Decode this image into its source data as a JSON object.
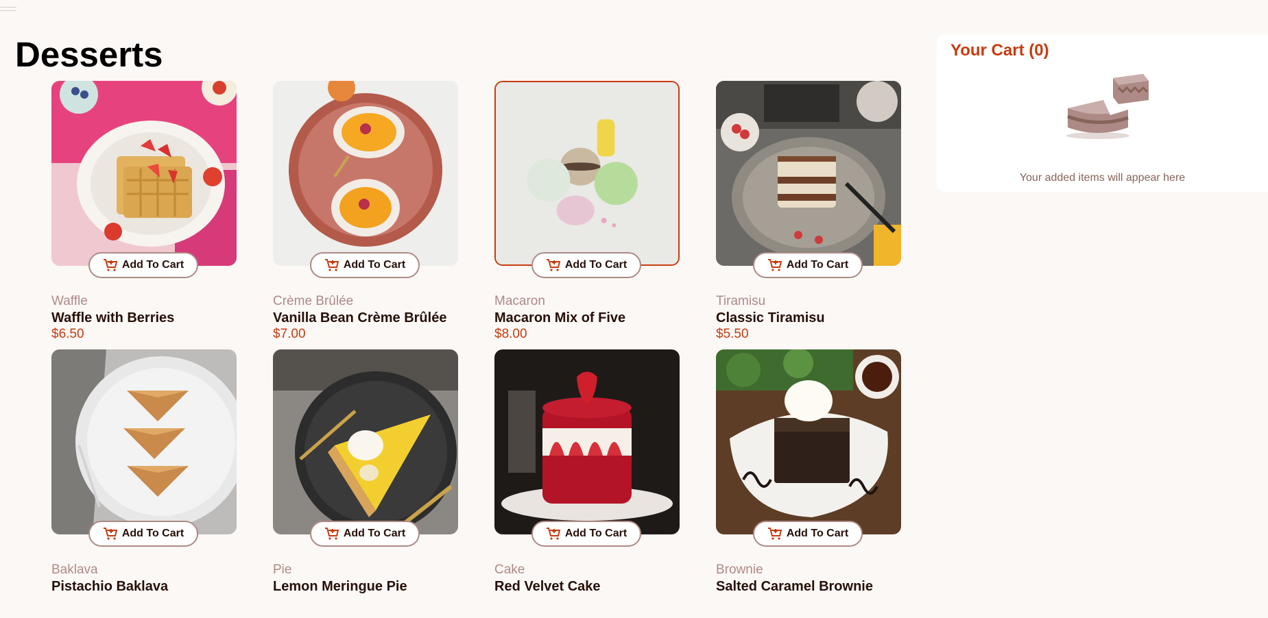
{
  "page": {
    "title": "Desserts"
  },
  "products": [
    {
      "category": "Waffle",
      "name": "Waffle with Berries",
      "price": "$6.50",
      "image": "waffle-image",
      "button": "Add To Cart"
    },
    {
      "category": "Crème Brûlée",
      "name": "Vanilla Bean Crème Brûlée",
      "price": "$7.00",
      "image": "creme-brulee-image",
      "button": "Add To Cart"
    },
    {
      "category": "Macaron",
      "name": "Macaron Mix of Five",
      "price": "$8.00",
      "image": "macaron-image",
      "button": "Add To Cart"
    },
    {
      "category": "Tiramisu",
      "name": "Classic Tiramisu",
      "price": "$5.50",
      "image": "tiramisu-image",
      "button": "Add To Cart"
    },
    {
      "category": "Baklava",
      "name": "Pistachio Baklava",
      "price": "",
      "image": "baklava-image",
      "button": "Add To Cart"
    },
    {
      "category": "Pie",
      "name": "Lemon Meringue Pie",
      "price": "",
      "image": "pie-image",
      "button": "Add To Cart"
    },
    {
      "category": "Cake",
      "name": "Red Velvet Cake",
      "price": "",
      "image": "cake-image",
      "button": "Add To Cart"
    },
    {
      "category": "Brownie",
      "name": "Salted Caramel Brownie",
      "price": "",
      "image": "brownie-image",
      "button": "Add To Cart"
    }
  ],
  "cart": {
    "title": "Your Cart (0)",
    "empty_message": "Your added items will appear here",
    "illustration": "empty-cart-cake-icon"
  },
  "colors": {
    "accent": "#c73b0f",
    "background": "#fcf8f6",
    "muted": "#ad8a85",
    "text": "#260f08"
  }
}
